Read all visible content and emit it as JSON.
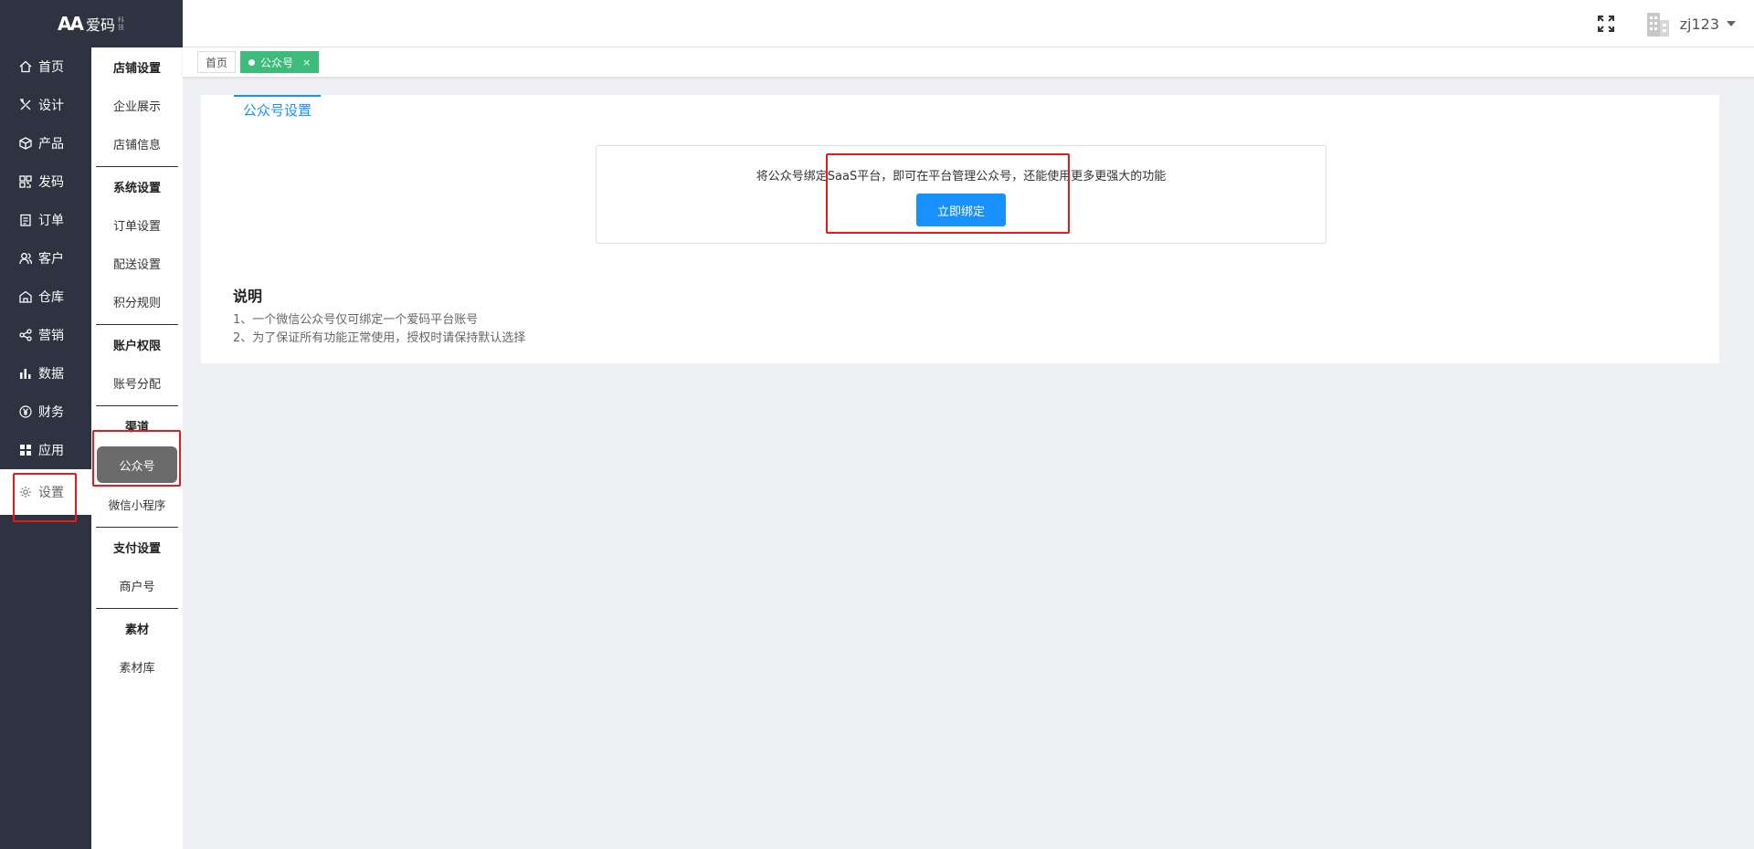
{
  "logo": {
    "mark": "AA",
    "name": "爱码",
    "sub": "科技"
  },
  "header": {
    "username": "zj123"
  },
  "sidebar": {
    "items": [
      {
        "label": "首页",
        "icon": "home-icon"
      },
      {
        "label": "设计",
        "icon": "design-icon"
      },
      {
        "label": "产品",
        "icon": "box-icon"
      },
      {
        "label": "发码",
        "icon": "qrcode-icon"
      },
      {
        "label": "订单",
        "icon": "order-icon"
      },
      {
        "label": "客户",
        "icon": "customer-icon"
      },
      {
        "label": "仓库",
        "icon": "warehouse-icon"
      },
      {
        "label": "营销",
        "icon": "share-icon"
      },
      {
        "label": "数据",
        "icon": "chart-icon"
      },
      {
        "label": "财务",
        "icon": "yen-icon"
      },
      {
        "label": "应用",
        "icon": "apps-icon"
      },
      {
        "label": "设置",
        "icon": "gear-icon"
      }
    ]
  },
  "subnav": {
    "groups": [
      {
        "head": "店铺设置",
        "items": [
          "企业展示",
          "店铺信息"
        ]
      },
      {
        "head": "系统设置",
        "items": [
          "订单设置",
          "配送设置",
          "积分规则"
        ]
      },
      {
        "head": "账户权限",
        "items": [
          "账号分配"
        ]
      },
      {
        "head": "渠道",
        "items": [
          "公众号",
          "微信小程序"
        ]
      },
      {
        "head": "支付设置",
        "items": [
          "商户号"
        ]
      },
      {
        "head": "素材",
        "items": [
          "素材库"
        ]
      }
    ]
  },
  "tabs": [
    {
      "label": "首页"
    },
    {
      "label": "公众号",
      "close": "×"
    }
  ],
  "panel": {
    "tab_label": "公众号设置",
    "bind_text": "将公众号绑定SaaS平台，即可在平台管理公众号，还能使用更多更强大的功能",
    "bind_button": "立即绑定",
    "explain_title": "说明",
    "explain_lines": [
      "1、一个微信公众号仅可绑定一个爱码平台账号",
      "2、为了保证所有功能正常使用，授权时请保持默认选择"
    ]
  },
  "colors": {
    "sidebar_bg": "#2d3340",
    "accent": "#1890ff",
    "tab_active": "#3dbb7a",
    "annotation": "#e61c1c"
  }
}
